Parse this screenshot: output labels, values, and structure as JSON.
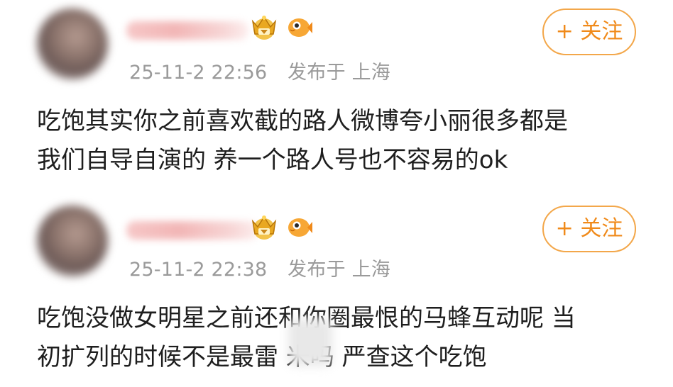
{
  "posts": [
    {
      "timestamp": "25-11-2 22:56",
      "location_label": "发布于",
      "location": "上海",
      "follow_label": "+ 关注",
      "badges": [
        "crown-icon",
        "fish-icon"
      ],
      "content_lines": [
        "吃饱其实你之前喜欢截的路人微博夸小丽很多都是",
        "我们自导自演的 养一个路人号也不容易的ok"
      ]
    },
    {
      "timestamp": "25-11-2 22:38",
      "location_label": "发布于",
      "location": "上海",
      "follow_label": "+ 关注",
      "badges": [
        "crown-icon",
        "fish-icon"
      ],
      "content_lines": [
        "吃饱没做女明星之前还和你圈最恨的马蜂互动呢 当",
        "初扩列的时候不是最雷 米吗 严查这个吃饱"
      ]
    }
  ],
  "colors": {
    "accent": "#f08a1a",
    "meta_text": "#9a9a9a",
    "body_text": "#1e1e1e"
  }
}
